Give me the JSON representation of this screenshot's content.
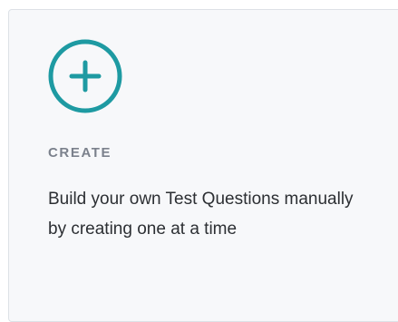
{
  "card": {
    "icon": "plus-circle-icon",
    "title": "CREATE",
    "description": "Build your own Test Questions manually by creating one at a time"
  },
  "colors": {
    "accent": "#1e9aa2",
    "title": "#7b818c",
    "text": "#2c2f33",
    "card_background": "#f7f8fa",
    "card_border": "#dde1e6"
  }
}
